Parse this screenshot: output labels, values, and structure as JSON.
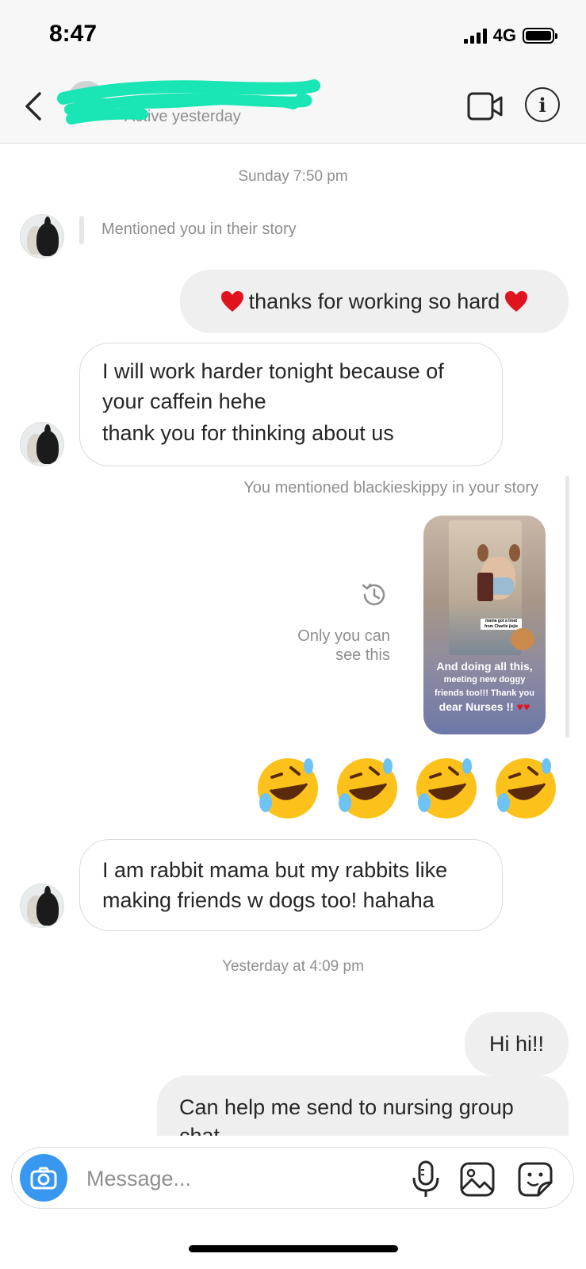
{
  "status_bar": {
    "time": "8:47",
    "network": "4G"
  },
  "header": {
    "contact_name": "",
    "status": "Active yesterday"
  },
  "messages": {
    "ts_sunday": "Sunday 7:50 pm",
    "mention_notice": "Mentioned you in their story",
    "out_thanks": "thanks for working so hard",
    "in_1_line1": "I will work harder tonight because of your caffein hehe",
    "in_1_line2": "thank you for thinking about us",
    "you_mentioned": "You mentioned blackieskippy in your story",
    "story_caption_1": "And doing all this,",
    "story_caption_2": "meeting new doggy",
    "story_caption_3": "friends too!!! Thank you",
    "story_caption_4": "dear Nurses !!",
    "story_sticker": "mama got a treat from Charlie jiejie",
    "only_you": "Only you can see this",
    "in_2": "I am rabbit mama but my rabbits like making friends w dogs too! hahaha",
    "ts_yesterday": "Yesterday at 4:09 pm",
    "out_hi": "Hi hi!!",
    "out_last": "Can help me send to nursing group chat"
  },
  "composer": {
    "placeholder": "Message..."
  },
  "colors": {
    "accent": "#3897f0",
    "redaction": "#19e6b4",
    "heart": "#e0141e"
  },
  "icons": [
    "back-chevron-icon",
    "video-call-icon",
    "info-icon",
    "history-icon",
    "camera-icon",
    "microphone-icon",
    "gallery-icon",
    "sticker-icon"
  ]
}
